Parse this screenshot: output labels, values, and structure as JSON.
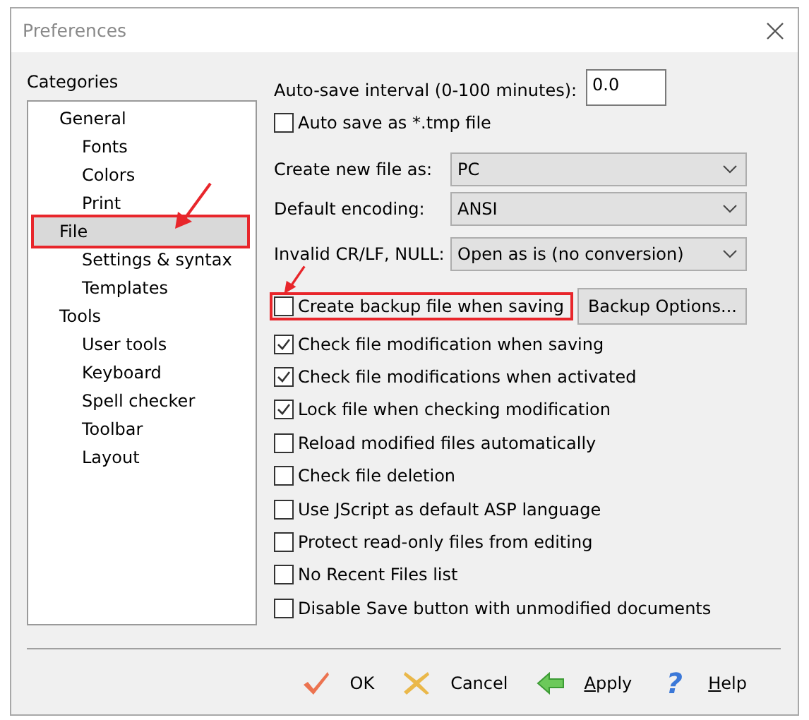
{
  "window": {
    "title": "Preferences"
  },
  "categories": {
    "label": "Categories",
    "tree": [
      {
        "label": "General",
        "selected": false,
        "annotated": false,
        "children": [
          {
            "label": "Fonts",
            "selected": false,
            "annotated": false
          },
          {
            "label": "Colors",
            "selected": false,
            "annotated": false
          },
          {
            "label": "Print",
            "selected": false,
            "annotated": false
          }
        ]
      },
      {
        "label": "File",
        "selected": true,
        "annotated": true,
        "children": [
          {
            "label": "Settings & syntax",
            "selected": false,
            "annotated": false
          },
          {
            "label": "Templates",
            "selected": false,
            "annotated": false
          }
        ]
      },
      {
        "label": "Tools",
        "selected": false,
        "annotated": false,
        "children": [
          {
            "label": "User tools",
            "selected": false,
            "annotated": false
          },
          {
            "label": "Keyboard",
            "selected": false,
            "annotated": false
          },
          {
            "label": "Spell checker",
            "selected": false,
            "annotated": false
          },
          {
            "label": "Toolbar",
            "selected": false,
            "annotated": false
          },
          {
            "label": "Layout",
            "selected": false,
            "annotated": false
          }
        ]
      }
    ]
  },
  "autosave": {
    "label": "Auto-save interval (0-100 minutes):",
    "value": "0.0"
  },
  "autosave_tmp": {
    "label": "Auto save as *.tmp file",
    "checked": false
  },
  "selects": [
    {
      "label": "Create new file as:",
      "value": "PC"
    },
    {
      "label": "Default encoding:",
      "value": "ANSI"
    },
    {
      "label": "Invalid CR/LF, NULL:",
      "value": "Open as is (no conversion)"
    }
  ],
  "backup": {
    "label": "Create backup file when saving",
    "checked": false,
    "annotated": true,
    "button": "Backup Options..."
  },
  "checks": [
    {
      "label": "Check file modification when saving",
      "checked": true
    },
    {
      "label": "Check file modifications when activated",
      "checked": true
    },
    {
      "label": "Lock file when checking modification",
      "checked": true
    },
    {
      "label": "Reload modified files automatically",
      "checked": false
    },
    {
      "label": "Check file deletion",
      "checked": false
    },
    {
      "label": "Use JScript as default ASP language",
      "checked": false
    },
    {
      "label": "Protect read-only files from editing",
      "checked": false
    },
    {
      "label": "No Recent Files list",
      "checked": false
    },
    {
      "label": "Disable Save button with unmodified documents",
      "checked": false
    }
  ],
  "buttons": [
    {
      "kind": "ok",
      "label": "OK",
      "underline_first": false
    },
    {
      "kind": "cancel",
      "label": "Cancel",
      "underline_first": false
    },
    {
      "kind": "apply",
      "label": "Apply",
      "underline_first": true
    },
    {
      "kind": "help",
      "label": "Help",
      "underline_first": true,
      "glyph": "?"
    }
  ]
}
